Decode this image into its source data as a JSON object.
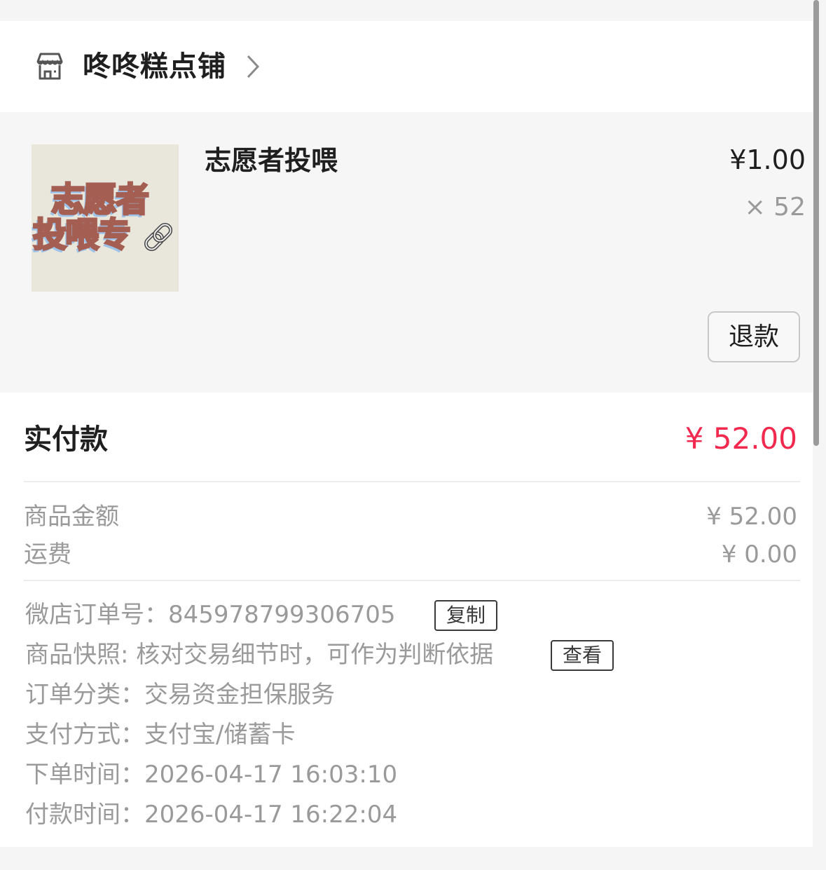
{
  "shop": {
    "name": "咚咚糕点铺",
    "icon": "shop-icon",
    "chevron_icon": "chevron-right-icon"
  },
  "item": {
    "thumbnail_line1": "志愿者",
    "thumbnail_line2": "投喂专",
    "thumbnail_icon": "link-icon",
    "title": "志愿者投喂",
    "price": "¥1.00",
    "quantity": "× 52",
    "refund_label": "退款"
  },
  "payment": {
    "paid_label": "实付款",
    "paid_value": "¥ 52.00",
    "goods_amount_label": "商品金额",
    "goods_amount_value": "¥ 52.00",
    "shipping_label": "运费",
    "shipping_value": "¥ 0.00"
  },
  "order_info": {
    "order_number": "微店订单号：845978799306705",
    "copy_label": "复制",
    "snapshot": "商品快照: 核对交易细节时，可作为判断依据",
    "view_label": "查看",
    "category": "订单分类：交易资金担保服务",
    "payment_method": "支付方式：支付宝/储蓄卡",
    "order_time": "下单时间：2026-04-17 16:03:10",
    "pay_time": "付款时间：2026-04-17 16:22:04"
  },
  "colors": {
    "accent_price": "#f2294e",
    "secondary_text": "#9a9a9a",
    "primary_text": "#1f1f1f"
  }
}
